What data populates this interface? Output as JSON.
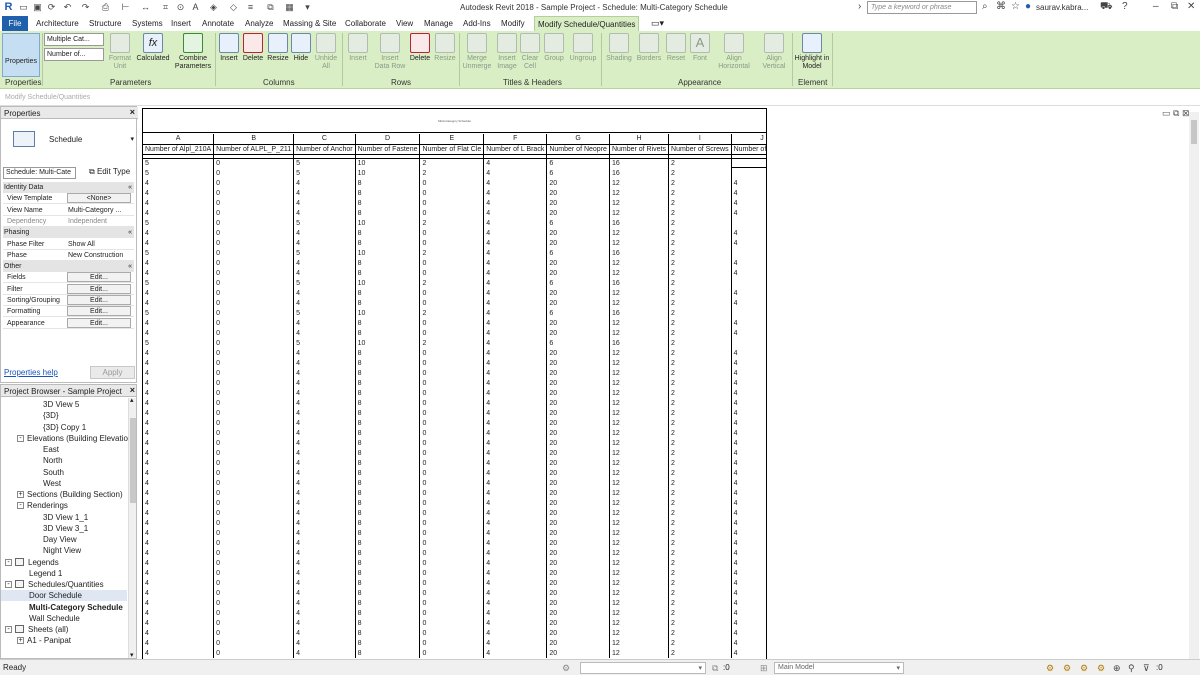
{
  "titlebar": {
    "app_title": "Autodesk Revit 2018 -     Sample Project - Schedule: Multi-Category Schedule",
    "search_placeholder": "Type a keyword or phrase",
    "user": "saurav.kabra...",
    "help": "?"
  },
  "menu": {
    "tabs": [
      "File",
      "Architecture",
      "Structure",
      "Systems",
      "Insert",
      "Annotate",
      "Analyze",
      "Massing & Site",
      "Collaborate",
      "View",
      "Manage",
      "Add-Ins",
      "Modify",
      "Modify Schedule/Quantities"
    ]
  },
  "ribbon": {
    "properties": "Properties",
    "combo1": "Multiple Cat...",
    "combo2": "Number of...",
    "buttons": {
      "format_unit": "Format Unit",
      "calculated": "Calculated",
      "combine": "Combine Parameters",
      "insert": "Insert",
      "delete": "Delete",
      "resize": "Resize",
      "hide": "Hide",
      "unhide": "Unhide All",
      "insert_row": "Insert",
      "insert_data_row": "Insert Data Row",
      "delete_row": "Delete",
      "resize_row": "Resize",
      "merge": "Merge Unmerge",
      "insert_image": "Insert Image",
      "clear_cell": "Clear Cell",
      "group": "Group",
      "ungroup": "Ungroup",
      "shading": "Shading",
      "borders": "Borders",
      "reset": "Reset",
      "font": "Font",
      "align_h": "Align Horizontal",
      "align_v": "Align Vertical",
      "highlight": "Highlight in Model"
    },
    "panels": [
      "Properties",
      "Parameters",
      "Columns",
      "Rows",
      "Titles & Headers",
      "Appearance",
      "Element"
    ]
  },
  "context": "Modify Schedule/Quantities",
  "properties_palette": {
    "title": "Properties",
    "type_name": "Schedule",
    "instance": "Schedule: Multi-Cate",
    "edit_type": "Edit Type",
    "rows": [
      {
        "group": "Identity Data"
      },
      {
        "k": "View Template",
        "v": "<None>",
        "btn": true
      },
      {
        "k": "View Name",
        "v": "Multi-Category ..."
      },
      {
        "k": "Dependency",
        "v": "Independent",
        "dim": true
      },
      {
        "group": "Phasing"
      },
      {
        "k": "Phase Filter",
        "v": "Show All"
      },
      {
        "k": "Phase",
        "v": "New Construction"
      },
      {
        "group": "Other"
      },
      {
        "k": "Fields",
        "v": "Edit...",
        "btn": true
      },
      {
        "k": "Filter",
        "v": "Edit...",
        "btn": true
      },
      {
        "k": "Sorting/Grouping",
        "v": "Edit...",
        "btn": true
      },
      {
        "k": "Formatting",
        "v": "Edit...",
        "btn": true
      },
      {
        "k": "Appearance",
        "v": "Edit...",
        "btn": true
      }
    ],
    "help": "Properties help",
    "apply": "Apply"
  },
  "project_browser": {
    "title": "Project Browser - Sample Project",
    "items": [
      {
        "t": "3D View 5",
        "lvl": 3
      },
      {
        "t": "{3D}",
        "lvl": 3
      },
      {
        "t": "{3D} Copy 1",
        "lvl": 3
      },
      {
        "t": "Elevations (Building Elevation",
        "lvl": 1,
        "box": "-"
      },
      {
        "t": "East",
        "lvl": 3
      },
      {
        "t": "North",
        "lvl": 3
      },
      {
        "t": "South",
        "lvl": 3
      },
      {
        "t": "West",
        "lvl": 3
      },
      {
        "t": "Sections (Building Section)",
        "lvl": 1,
        "box": "+"
      },
      {
        "t": "Renderings",
        "lvl": 1,
        "box": "-"
      },
      {
        "t": "3D View 1_1",
        "lvl": 3
      },
      {
        "t": "3D View 3_1",
        "lvl": 3
      },
      {
        "t": "Day View",
        "lvl": 3
      },
      {
        "t": "Night View",
        "lvl": 3
      },
      {
        "t": "Legends",
        "lvl": 0,
        "box": "-",
        "icon": true
      },
      {
        "t": "Legend 1",
        "lvl": 2
      },
      {
        "t": "Schedules/Quantities",
        "lvl": 0,
        "box": "-",
        "icon": true
      },
      {
        "t": "Door Schedule",
        "lvl": 2,
        "sel": true
      },
      {
        "t": "Multi-Category Schedule",
        "lvl": 2,
        "bold": true
      },
      {
        "t": "Wall Schedule",
        "lvl": 2
      },
      {
        "t": "Sheets (all)",
        "lvl": 0,
        "box": "-",
        "icon": true
      },
      {
        "t": "A1 - Panipat",
        "lvl": 1,
        "box": "+"
      }
    ]
  },
  "schedule": {
    "title": "Multi-Category Schedule",
    "letters": [
      "A",
      "B",
      "C",
      "D",
      "E",
      "F",
      "G",
      "H",
      "I",
      "J"
    ],
    "headers": [
      "Number of Alpl_210A",
      "Number of ALPL_P_211",
      "Number of Anchor",
      "Number of Fastene",
      "Number of Flat Cle",
      "Number of L Brack",
      "Number of Neopre",
      "Number of Rivets",
      "Number of Screws",
      "Number of Stiffner"
    ],
    "rows": [
      [
        "5",
        "0",
        "5",
        "10",
        "2",
        "4",
        "6",
        "16",
        "2",
        ""
      ],
      [
        "5",
        "0",
        "5",
        "10",
        "2",
        "4",
        "6",
        "16",
        "2",
        ""
      ],
      [
        "4",
        "0",
        "4",
        "8",
        "0",
        "4",
        "20",
        "12",
        "2",
        "4"
      ],
      [
        "4",
        "0",
        "4",
        "8",
        "0",
        "4",
        "20",
        "12",
        "2",
        "4"
      ],
      [
        "4",
        "0",
        "4",
        "8",
        "0",
        "4",
        "20",
        "12",
        "2",
        "4"
      ],
      [
        "4",
        "0",
        "4",
        "8",
        "0",
        "4",
        "20",
        "12",
        "2",
        "4"
      ],
      [
        "5",
        "0",
        "5",
        "10",
        "2",
        "4",
        "6",
        "16",
        "2",
        ""
      ],
      [
        "4",
        "0",
        "4",
        "8",
        "0",
        "4",
        "20",
        "12",
        "2",
        "4"
      ],
      [
        "4",
        "0",
        "4",
        "8",
        "0",
        "4",
        "20",
        "12",
        "2",
        "4"
      ],
      [
        "5",
        "0",
        "5",
        "10",
        "2",
        "4",
        "6",
        "16",
        "2",
        ""
      ],
      [
        "4",
        "0",
        "4",
        "8",
        "0",
        "4",
        "20",
        "12",
        "2",
        "4"
      ],
      [
        "4",
        "0",
        "4",
        "8",
        "0",
        "4",
        "20",
        "12",
        "2",
        "4"
      ],
      [
        "5",
        "0",
        "5",
        "10",
        "2",
        "4",
        "6",
        "16",
        "2",
        ""
      ],
      [
        "4",
        "0",
        "4",
        "8",
        "0",
        "4",
        "20",
        "12",
        "2",
        "4"
      ],
      [
        "4",
        "0",
        "4",
        "8",
        "0",
        "4",
        "20",
        "12",
        "2",
        "4"
      ],
      [
        "5",
        "0",
        "5",
        "10",
        "2",
        "4",
        "6",
        "16",
        "2",
        ""
      ],
      [
        "4",
        "0",
        "4",
        "8",
        "0",
        "4",
        "20",
        "12",
        "2",
        "4"
      ],
      [
        "4",
        "0",
        "4",
        "8",
        "0",
        "4",
        "20",
        "12",
        "2",
        "4"
      ],
      [
        "5",
        "0",
        "5",
        "10",
        "2",
        "4",
        "6",
        "16",
        "2",
        ""
      ],
      [
        "4",
        "0",
        "4",
        "8",
        "0",
        "4",
        "20",
        "12",
        "2",
        "4"
      ],
      [
        "4",
        "0",
        "4",
        "8",
        "0",
        "4",
        "20",
        "12",
        "2",
        "4"
      ],
      [
        "4",
        "0",
        "4",
        "8",
        "0",
        "4",
        "20",
        "12",
        "2",
        "4"
      ],
      [
        "4",
        "0",
        "4",
        "8",
        "0",
        "4",
        "20",
        "12",
        "2",
        "4"
      ],
      [
        "4",
        "0",
        "4",
        "8",
        "0",
        "4",
        "20",
        "12",
        "2",
        "4"
      ],
      [
        "4",
        "0",
        "4",
        "8",
        "0",
        "4",
        "20",
        "12",
        "2",
        "4"
      ],
      [
        "4",
        "0",
        "4",
        "8",
        "0",
        "4",
        "20",
        "12",
        "2",
        "4"
      ],
      [
        "4",
        "0",
        "4",
        "8",
        "0",
        "4",
        "20",
        "12",
        "2",
        "4"
      ],
      [
        "4",
        "0",
        "4",
        "8",
        "0",
        "4",
        "20",
        "12",
        "2",
        "4"
      ],
      [
        "4",
        "0",
        "4",
        "8",
        "0",
        "4",
        "20",
        "12",
        "2",
        "4"
      ],
      [
        "4",
        "0",
        "4",
        "8",
        "0",
        "4",
        "20",
        "12",
        "2",
        "4"
      ],
      [
        "4",
        "0",
        "4",
        "8",
        "0",
        "4",
        "20",
        "12",
        "2",
        "4"
      ],
      [
        "4",
        "0",
        "4",
        "8",
        "0",
        "4",
        "20",
        "12",
        "2",
        "4"
      ],
      [
        "4",
        "0",
        "4",
        "8",
        "0",
        "4",
        "20",
        "12",
        "2",
        "4"
      ],
      [
        "4",
        "0",
        "4",
        "8",
        "0",
        "4",
        "20",
        "12",
        "2",
        "4"
      ],
      [
        "4",
        "0",
        "4",
        "8",
        "0",
        "4",
        "20",
        "12",
        "2",
        "4"
      ],
      [
        "4",
        "0",
        "4",
        "8",
        "0",
        "4",
        "20",
        "12",
        "2",
        "4"
      ],
      [
        "4",
        "0",
        "4",
        "8",
        "0",
        "4",
        "20",
        "12",
        "2",
        "4"
      ],
      [
        "4",
        "0",
        "4",
        "8",
        "0",
        "4",
        "20",
        "12",
        "2",
        "4"
      ],
      [
        "4",
        "0",
        "4",
        "8",
        "0",
        "4",
        "20",
        "12",
        "2",
        "4"
      ],
      [
        "4",
        "0",
        "4",
        "8",
        "0",
        "4",
        "20",
        "12",
        "2",
        "4"
      ],
      [
        "4",
        "0",
        "4",
        "8",
        "0",
        "4",
        "20",
        "12",
        "2",
        "4"
      ],
      [
        "4",
        "0",
        "4",
        "8",
        "0",
        "4",
        "20",
        "12",
        "2",
        "4"
      ],
      [
        "4",
        "0",
        "4",
        "8",
        "0",
        "4",
        "20",
        "12",
        "2",
        "4"
      ],
      [
        "4",
        "0",
        "4",
        "8",
        "0",
        "4",
        "20",
        "12",
        "2",
        "4"
      ],
      [
        "4",
        "0",
        "4",
        "8",
        "0",
        "4",
        "20",
        "12",
        "2",
        "4"
      ],
      [
        "4",
        "0",
        "4",
        "8",
        "0",
        "4",
        "20",
        "12",
        "2",
        "4"
      ],
      [
        "4",
        "0",
        "4",
        "8",
        "0",
        "4",
        "20",
        "12",
        "2",
        "4"
      ],
      [
        "4",
        "0",
        "4",
        "8",
        "0",
        "4",
        "20",
        "12",
        "2",
        "4"
      ],
      [
        "4",
        "0",
        "4",
        "8",
        "0",
        "4",
        "20",
        "12",
        "2",
        "4"
      ],
      [
        "4",
        "0",
        "4",
        "8",
        "0",
        "4",
        "20",
        "12",
        "2",
        "4"
      ]
    ]
  },
  "statusbar": {
    "status": "Ready",
    "coord": ":0",
    "model": "Main Model",
    "filter": ":0"
  }
}
